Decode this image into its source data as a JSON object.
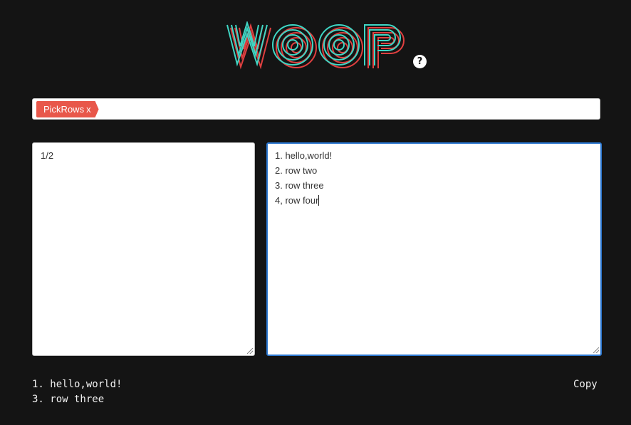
{
  "logo": {
    "text": "WOOP",
    "icon": "woop-logo"
  },
  "help": {
    "label": "?",
    "icon": "help-icon"
  },
  "pipeline": {
    "tags": [
      {
        "label": "PickRows",
        "remove_label": "x"
      }
    ]
  },
  "args_box": {
    "value": "1/2"
  },
  "input_box": {
    "lines": [
      "1. hello,world!",
      "2. row two",
      "3. row three",
      "4, row four"
    ]
  },
  "output": {
    "lines": [
      "1. hello,world!",
      "3. row three"
    ]
  },
  "copy": {
    "label": "Copy"
  },
  "colors": {
    "background": "#141414",
    "tag": "#e8574a",
    "focus": "#2b77d0",
    "logo_primary": "#3fd6c4",
    "logo_shadow": "#e04040"
  }
}
